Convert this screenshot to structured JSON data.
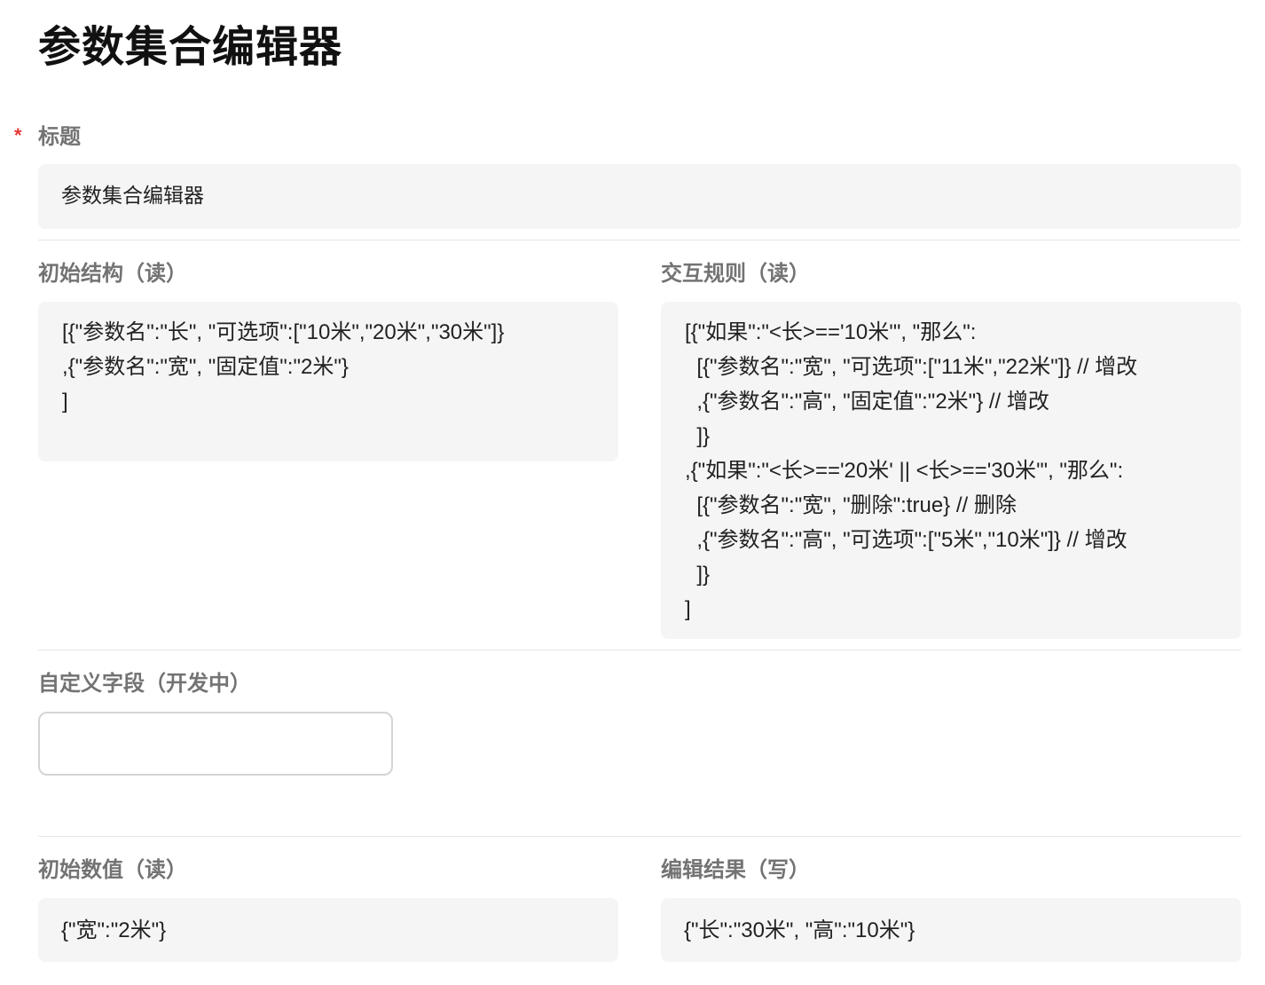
{
  "page": {
    "title": "参数集合编辑器"
  },
  "title_field": {
    "required_mark": "*",
    "label": "标题",
    "value": "参数集合编辑器"
  },
  "initial_structure": {
    "label": "初始结构（读）",
    "content": "[{\"参数名\":\"长\", \"可选项\":[\"10米\",\"20米\",\"30米\"]}\n,{\"参数名\":\"宽\", \"固定值\":\"2米\"}\n]"
  },
  "interaction_rules": {
    "label": "交互规则（读）",
    "content": "[{\"如果\":\"<长>=='10米'\", \"那么\":\n  [{\"参数名\":\"宽\", \"可选项\":[\"11米\",\"22米\"]} // 增改\n  ,{\"参数名\":\"高\", \"固定值\":\"2米\"} // 增改\n  ]}\n,{\"如果\":\"<长>=='20米' || <长>=='30米'\", \"那么\":\n  [{\"参数名\":\"宽\", \"删除\":true} // 删除\n  ,{\"参数名\":\"高\", \"可选项\":[\"5米\",\"10米\"]} // 增改\n  ]}\n]"
  },
  "custom_field": {
    "label": "自定义字段（开发中）",
    "value": ""
  },
  "initial_values": {
    "label": "初始数值（读）",
    "content": "{\"宽\":\"2米\"}"
  },
  "edit_result": {
    "label": "编辑结果（写）",
    "content": "{\"长\":\"30米\", \"高\":\"10米\"}"
  }
}
